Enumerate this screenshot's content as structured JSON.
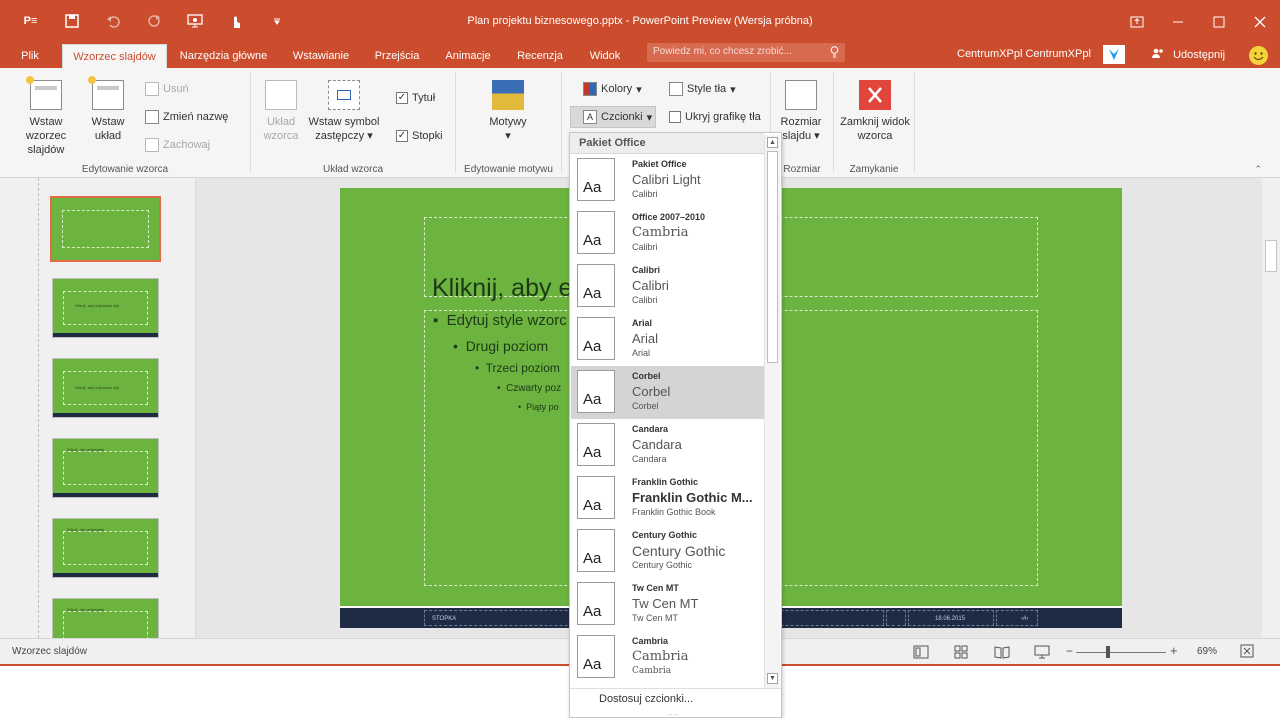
{
  "window": {
    "title": "Plan projektu biznesowego.pptx - PowerPoint Preview (Wersja próbna)",
    "qat": [
      "powerpoint-logo-icon",
      "save-icon",
      "undo-icon",
      "redo-icon",
      "present-icon",
      "touch-mode-icon",
      "customize-qat-icon"
    ],
    "app_badge": "P≡",
    "controls": [
      "ribbon-display-options-icon",
      "minimize-icon",
      "maximize-icon",
      "close-icon"
    ]
  },
  "tabs": {
    "items": [
      "Plik",
      "Wzorzec slajdów",
      "Narzędzia główne",
      "Wstawianie",
      "Przejścia",
      "Animacje",
      "Recenzja",
      "Widok"
    ],
    "active_index": 1,
    "tell_me": "Powiedz mi, co chcesz zrobić...",
    "user": "CentrumXPpl CentrumXPpl",
    "share": "Udostępnij"
  },
  "ribbon": {
    "edit_master": {
      "label": "Edytowanie wzorca",
      "insert_master": "Wstaw wzorzec slajdów",
      "insert_layout": "Wstaw układ",
      "delete": "Usuń",
      "rename": "Zmień nazwę",
      "preserve": "Zachowaj"
    },
    "master_layout": {
      "label": "Układ wzorca",
      "layout": "Układ wzorca",
      "insert_placeholder": "Wstaw symbol zastępczy",
      "title": "Tytuł",
      "footers": "Stopki",
      "title_checked": true,
      "footers_checked": true
    },
    "edit_theme": {
      "label": "Edytowanie motywu",
      "themes": "Motywy"
    },
    "background": {
      "colors": "Kolory",
      "fonts": "Czcionki",
      "bg_styles": "Style tła",
      "hide_bg": "Ukryj grafikę tła",
      "hide_bg_checked": false
    },
    "size": {
      "label": "Rozmiar",
      "slide_size": "Rozmiar slajdu"
    },
    "close": {
      "label": "Zamykanie",
      "close_view": "Zamknij widok wzorca"
    }
  },
  "slide": {
    "title": "Kliknij, aby e",
    "level1": "Edytuj style wzorc",
    "level2": "Drugi poziom",
    "level3": "Trzeci poziom",
    "level4": "Czwarty poz",
    "level5": "Piąty po",
    "footer": "STOPKA",
    "date": "18.06.2015",
    "page": "‹#›",
    "bullet1": "▪",
    "bullet2": "•",
    "bullet3": "•",
    "bullet4": "•",
    "bullet5": "•"
  },
  "thumbnails": {
    "texts": [
      "",
      "Kliknij, aby edytować styl",
      "Kliknij, aby edytować styl",
      "Kliknij, aby edytować",
      "Kliknij, aby edytować",
      "Kliknij, aby edytować"
    ]
  },
  "status": {
    "view": "Wzorzec slajdów",
    "zoom": "69%",
    "zoom_minus": "−",
    "zoom_plus": "+"
  },
  "fonts_dropdown": {
    "section": "Pakiet Office",
    "sample": "Aa",
    "items": [
      {
        "name": "Pakiet Office",
        "heading": "Calibri Light",
        "body": "Calibri"
      },
      {
        "name": "Office 2007–2010",
        "heading": "Cambria",
        "body": "Calibri"
      },
      {
        "name": "Calibri",
        "heading": "Calibri",
        "body": "Calibri"
      },
      {
        "name": "Arial",
        "heading": "Arial",
        "body": "Arial"
      },
      {
        "name": "Corbel",
        "heading": "Corbel",
        "body": "Corbel"
      },
      {
        "name": "Candara",
        "heading": "Candara",
        "body": "Candara"
      },
      {
        "name": "Franklin Gothic",
        "heading": "Franklin Gothic M...",
        "body": "Franklin Gothic Book"
      },
      {
        "name": "Century Gothic",
        "heading": "Century Gothic",
        "body": "Century Gothic"
      },
      {
        "name": "Tw Cen MT",
        "heading": "Tw Cen MT",
        "body": "Tw Cen MT"
      },
      {
        "name": "Cambria",
        "heading": "Cambria",
        "body": "Cambria"
      }
    ],
    "hover_index": 4,
    "customize": "Dostosuj czcionki...",
    "grip": "....",
    "scroll_up": "▲",
    "scroll_down": "▼"
  },
  "colors": {
    "accent": "#cb4d2d",
    "slide_bg": "#6db33f",
    "slide_footer": "#1f2a44"
  }
}
